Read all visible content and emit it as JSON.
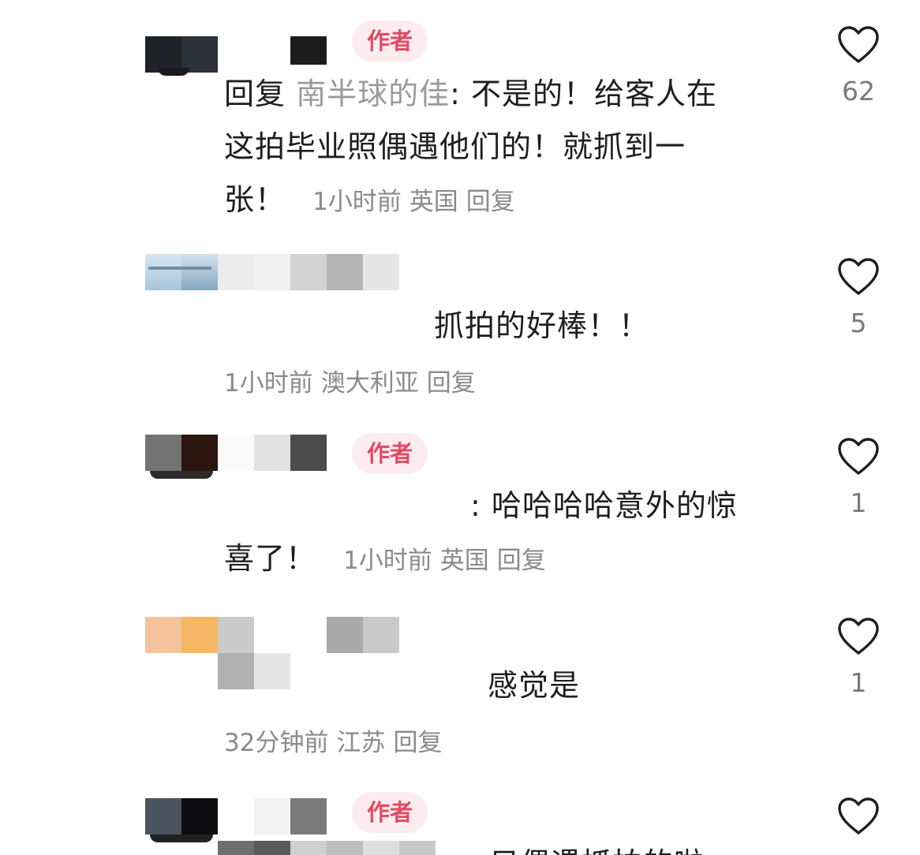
{
  "comments": [
    {
      "author_badge": "作者",
      "reply_prefix": "回复 ",
      "mention": "南半球的佳",
      "text_line1": ": 不是的！给客人在",
      "text_line2": "这拍毕业照偶遇他们的！就抓到一",
      "text_line3": "张！",
      "time": "1小时前",
      "location": "英国",
      "reply": "回复",
      "likes": "62"
    },
    {
      "text": "抓拍的好棒！！",
      "time": "1小时前",
      "location": "澳大利亚",
      "reply": "回复",
      "likes": "5"
    },
    {
      "author_badge": "作者",
      "text_line1": ": 哈哈哈哈意外的惊",
      "text_line2": "喜了！",
      "time": "1小时前",
      "location": "英国",
      "reply": "回复",
      "likes": "1"
    },
    {
      "text": "感觉是",
      "time": "32分钟前",
      "location": "江苏",
      "reply": "回复",
      "likes": "1"
    },
    {
      "author_badge": "作者",
      "text": "只偶遇抓拍的啦"
    }
  ],
  "icons": {
    "like": "heart-outline-icon"
  },
  "colors": {
    "author_badge_bg": "#fdecef",
    "author_badge_text": "#e24a63",
    "meta_text": "#8a8a8a",
    "mention_text": "#9a9a9a"
  }
}
